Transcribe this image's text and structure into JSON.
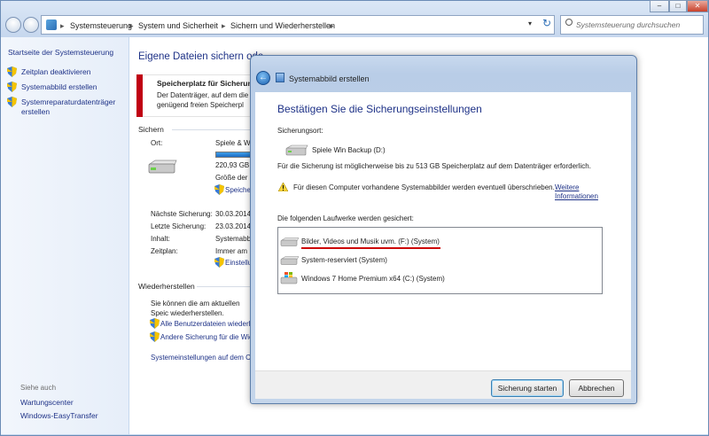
{
  "breadcrumbs": [
    "Systemsteuerung",
    "System und Sicherheit",
    "Sichern und Wiederherstellen"
  ],
  "search": {
    "placeholder": "Systemsteuerung durchsuchen"
  },
  "sidebar": {
    "home": "Startseite der Systemsteuerung",
    "items": [
      {
        "label": "Zeitplan deaktivieren"
      },
      {
        "label": "Systemabbild erstellen"
      },
      {
        "label": "Systemreparaturdatenträger erstellen"
      }
    ],
    "see_also": "Siehe auch",
    "see_also_items": [
      "Wartungscenter",
      "Windows-EasyTransfer"
    ]
  },
  "main": {
    "title": "Eigene Dateien sichern ode",
    "warning_title": "Speicherplatz für Sicherung",
    "warning_text": "Der Datenträger, auf dem die genügend freien Speicherpl",
    "sichern": "Sichern",
    "ort_label": "Ort:",
    "ort_value": "Spiele & W",
    "free_space": "220,93 GB fr",
    "size_label": "Größe der S",
    "speicher_link": "Speicher",
    "next_label": "Nächste Sicherung:",
    "next_value": "30.03.2014",
    "last_label": "Letzte Sicherung:",
    "last_value": "23.03.2014",
    "content_label": "Inhalt:",
    "content_value": "Systemabb",
    "schedule_label": "Zeitplan:",
    "schedule_value": "Immer am",
    "settings_link": "Einstellu",
    "restore_heading": "Wiederherstellen",
    "restore_text": "Sie können die am aktuellen Speic wiederherstellen.",
    "restore_all_link": "Alle Benutzerdateien wiederh",
    "other_backup_link": "Andere Sicherung für die Wie",
    "system_settings_link": "Systemeinstellungen auf dem C"
  },
  "dialog": {
    "title": "Systemabbild erstellen",
    "heading": "Bestätigen Sie die Sicherungseinstellungen",
    "location_label": "Sicherungsort:",
    "location_value": "Spiele  Win Backup (D:)",
    "space_text": "Für die Sicherung ist möglicherweise bis zu 513 GB Speicherplatz auf dem Datenträger erforderlich.",
    "overwrite_text": "Für diesen Computer vorhandene Systemabbilder werden eventuell überschrieben.",
    "more_info_link": "Weitere Informationen",
    "drives_label": "Die folgenden Laufwerke werden gesichert:",
    "drives": [
      "Bilder, Videos und Musik uvm. (F:) (System)",
      "System-reserviert (System)",
      "Windows 7 Home Premium x64 (C:) (System)"
    ],
    "start_button": "Sicherung starten",
    "cancel_button": "Abbrechen"
  }
}
